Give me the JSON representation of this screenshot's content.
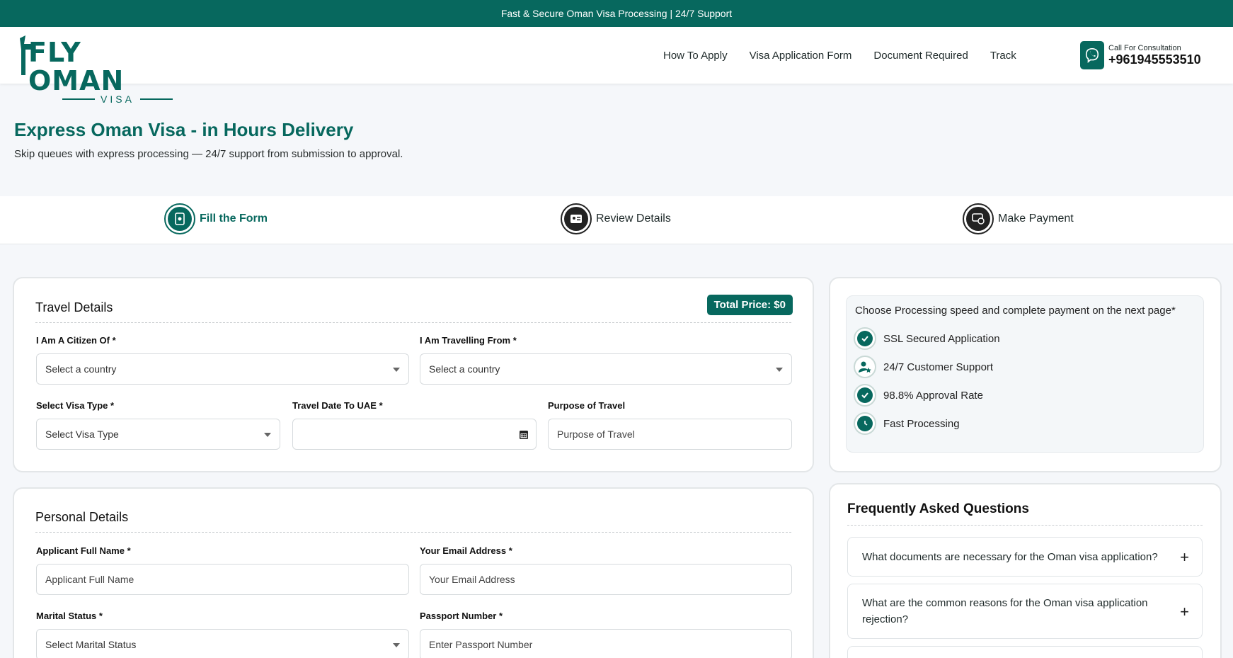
{
  "topbar": {
    "text": "Fast & Secure Oman Visa Processing | 24/7 Support"
  },
  "logo": {
    "main": "FLY OMAN",
    "sub": "VISA"
  },
  "nav": {
    "items": [
      "How To Apply",
      "Visa Application Form",
      "Document Required",
      "Track"
    ]
  },
  "consult": {
    "label": "Call For Consultation",
    "phone": "+961945553510"
  },
  "hero": {
    "title": "Express Oman Visa - in Hours Delivery",
    "subtitle": "Skip queues with express processing — 24/7 support from submission to approval."
  },
  "steps": [
    "Fill the Form",
    "Review Details",
    "Make Payment"
  ],
  "travel": {
    "title": "Travel Details",
    "price": "Total Price: $0",
    "citizen_label": "I Am A Citizen Of *",
    "citizen_value": "Select a country",
    "from_label": "I Am Travelling From *",
    "from_value": "Select a country",
    "visa_label": "Select Visa Type *",
    "visa_value": "Select Visa Type",
    "date_label": "Travel Date To UAE *",
    "purpose_label": "Purpose of Travel",
    "purpose_placeholder": "Purpose of Travel"
  },
  "personal": {
    "title": "Personal Details",
    "name_label": "Applicant Full Name *",
    "name_placeholder": "Applicant Full Name",
    "email_label": "Your Email Address *",
    "email_placeholder": "Your Email Address",
    "marital_label": "Marital Status *",
    "marital_value": "Select Marital Status",
    "passport_label": "Passport Number *",
    "passport_placeholder": "Enter Passport Number"
  },
  "info": {
    "heading": "Choose Processing speed and complete payment on the next page*",
    "features": [
      "SSL Secured Application",
      "24/7 Customer Support",
      "98.8% Approval Rate",
      "Fast Processing"
    ]
  },
  "faq": {
    "title": "Frequently Asked Questions",
    "items": [
      "What documents are necessary for the Oman visa application?",
      "What are the common reasons for the Oman visa application rejection?"
    ]
  },
  "colors": {
    "brand": "#07685e"
  }
}
